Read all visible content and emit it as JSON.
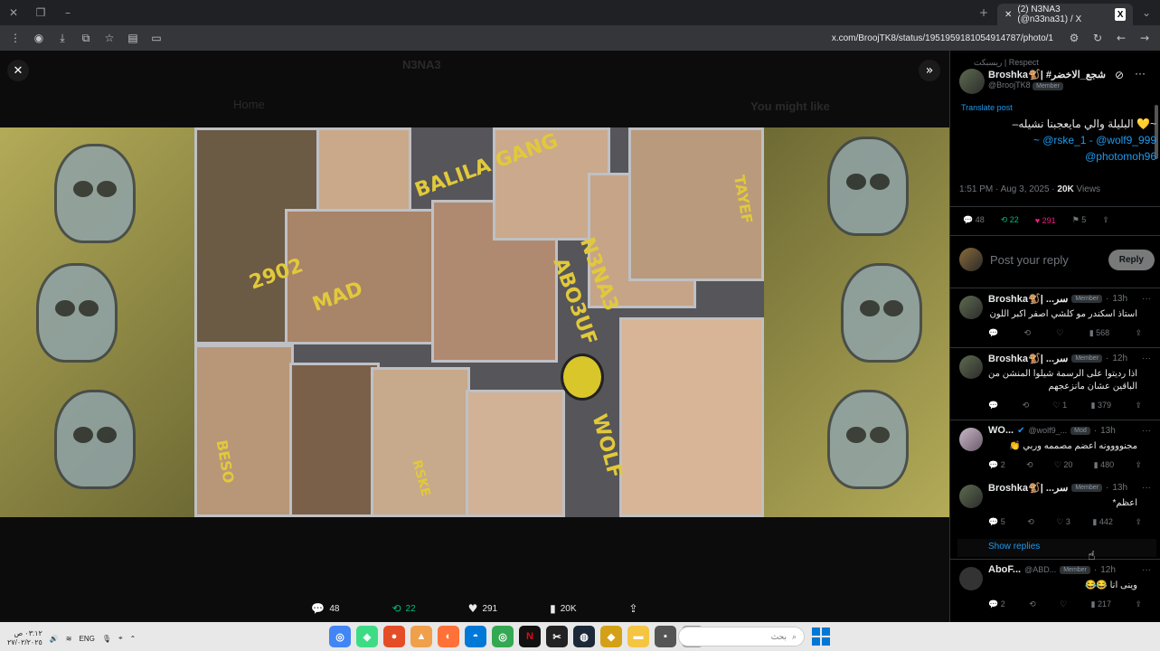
{
  "browser": {
    "tab_title": "(2) N3NA3 (@n33na31) / X",
    "tab_logo": "X",
    "url": "x.com/BroojTK8/status/1951959181054914787/photo/1"
  },
  "viewer": {
    "background_ghost": {
      "profile_name": "N3NA3",
      "nav_home": "Home",
      "sidebar_title": "You might like"
    },
    "stats": {
      "replies": "48",
      "reposts": "22",
      "likes": "291",
      "views": "20K"
    }
  },
  "artwork_tags": {
    "t1": "BALILA GANG",
    "t2": "2902",
    "t3": "MAD",
    "t4": "ABO3UF",
    "t5": "N3NA3",
    "t6": "WOLF",
    "t7": "TAYEF",
    "t8": "RSKE",
    "t9": "BESO"
  },
  "panel": {
    "respect_line": "ريسبكت | Respect",
    "post": {
      "display_name": "Broshka🐒| #شجع_الاخضر",
      "handle": "@BroojTK8",
      "member_badge": "Member",
      "translate": "Translate post",
      "text_line1": "–البليلة والي مايعجبنا نشيله 💛~",
      "text_line2": "~ @rske_1 - @wolf9_999",
      "text_line3": "@photomoh96",
      "meta_time": "1:51 PM · Aug 3, 2025 · ",
      "meta_views": "20K",
      "meta_views_label": "Views",
      "replies": "48",
      "reposts": "22",
      "likes": "291",
      "bookmarks": "5"
    },
    "reply_placeholder": "Post your reply",
    "reply_button": "Reply",
    "comments": [
      {
        "name": "Broshka🐒| ...سر",
        "badge": "Member",
        "time": "13h",
        "text": "استاذ اسكندر مو كلشي اصفر اكبر اللون",
        "replies": "",
        "reposts": "",
        "likes": "",
        "views": "568"
      },
      {
        "name": "Broshka🐒| ...سر",
        "badge": "Member",
        "time": "12h",
        "text": "اذا رديتوا على الرسمة شيلوا المنشن من الباقين عشان مانزعجهم",
        "replies": "",
        "reposts": "",
        "likes": "1",
        "views": "379"
      },
      {
        "name": "WO...",
        "handle": "@wolf9_...",
        "badge": "Mod",
        "time": "13h",
        "text": "مجنوووونه اعضم مصممه وربي 👏",
        "replies": "2",
        "reposts": "",
        "likes": "20",
        "views": "480"
      },
      {
        "name": "Broshka🐒| ...سر",
        "badge": "Member",
        "time": "13h",
        "text": "اعظم*",
        "replies": "5",
        "reposts": "",
        "likes": "3",
        "views": "442"
      },
      {
        "name": "AboF...",
        "handle": "@ABD...",
        "badge": "Member",
        "time": "12h",
        "text": "وينى انا 😂😂",
        "replies": "2",
        "reposts": "",
        "likes": "",
        "views": "217"
      }
    ],
    "show_replies": "Show replies"
  },
  "taskbar": {
    "clock_time": "٠٣:١٢ ص",
    "clock_date": "٢٧/٠٢/٢٠٢٥",
    "lang": "ENG",
    "search_placeholder": "بحث"
  }
}
